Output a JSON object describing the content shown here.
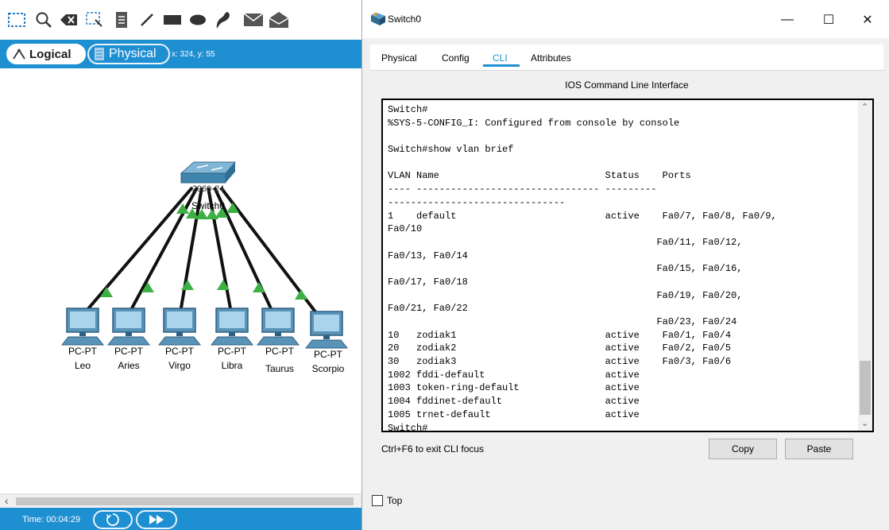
{
  "toolbar": {
    "icons": [
      "select-icon",
      "zoom-icon",
      "delete-icon",
      "resize-icon",
      "note-icon",
      "line-icon",
      "rectangle-icon",
      "ellipse-icon",
      "freeform-icon",
      "pdu-icon",
      "complex-pdu-icon"
    ]
  },
  "viewbar": {
    "logical_label": "Logical",
    "physical_label": "Physical",
    "coords": "x: 324, y: 55"
  },
  "topology": {
    "switch": {
      "model": "2960-24",
      "name": "Switch0"
    },
    "pcs": [
      {
        "type": "PC-PT",
        "name": "Leo"
      },
      {
        "type": "PC-PT",
        "name": "Aries"
      },
      {
        "type": "PC-PT",
        "name": "Virgo"
      },
      {
        "type": "PC-PT",
        "name": "Libra"
      },
      {
        "type": "PC-PT",
        "name": "Taurus"
      },
      {
        "type": "PC-PT",
        "name": "Scorpio"
      }
    ],
    "link_color": "#111111",
    "link_light_color": "#3cb043"
  },
  "statusbar": {
    "time": "Time: 00:04:29"
  },
  "window": {
    "title": "Switch0",
    "minimize": "—",
    "maximize": "☐",
    "close": "✕",
    "tabs": [
      {
        "label": "Physical"
      },
      {
        "label": "Config"
      },
      {
        "label": "CLI"
      },
      {
        "label": "Attributes"
      }
    ],
    "active_tab": "CLI",
    "cli_heading": "IOS Command Line Interface",
    "terminal_lines": [
      "Switch#",
      "%SYS-5-CONFIG_I: Configured from console by console",
      "",
      "Switch#show vlan brief",
      "",
      "VLAN Name                             Status    Ports",
      "---- -------------------------------- ---------",
      "-------------------------------",
      "1    default                          active    Fa0/7, Fa0/8, Fa0/9,",
      "Fa0/10",
      "                                               Fa0/11, Fa0/12,",
      "Fa0/13, Fa0/14",
      "                                               Fa0/15, Fa0/16,",
      "Fa0/17, Fa0/18",
      "                                               Fa0/19, Fa0/20,",
      "Fa0/21, Fa0/22",
      "                                               Fa0/23, Fa0/24",
      "10   zodiak1                          active    Fa0/1, Fa0/4",
      "20   zodiak2                          active    Fa0/2, Fa0/5",
      "30   zodiak3                          active    Fa0/3, Fa0/6",
      "1002 fddi-default                     active",
      "1003 token-ring-default               active",
      "1004 fddinet-default                  active",
      "1005 trnet-default                    active",
      "Switch#"
    ],
    "hint": "Ctrl+F6 to exit CLI focus",
    "copy_label": "Copy",
    "paste_label": "Paste",
    "top_label": "Top",
    "top_checked": false
  },
  "colors": {
    "accent": "#1e8fd1"
  }
}
